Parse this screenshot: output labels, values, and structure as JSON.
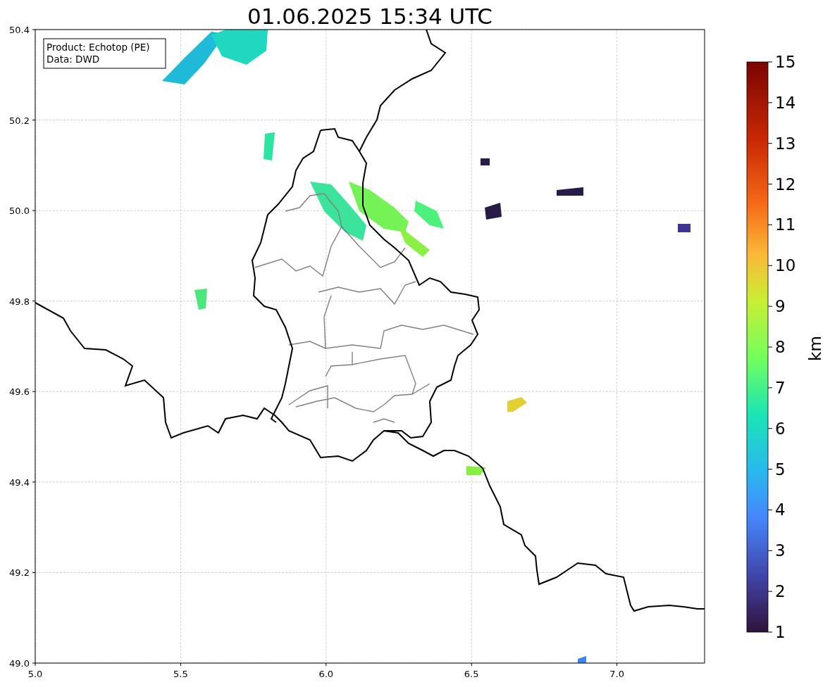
{
  "title": "01.06.2025 15:34 UTC",
  "legend": [
    "Product: Echotop (PE)",
    "Data: DWD"
  ],
  "x_ticks": [
    "5.0",
    "5.5",
    "6.0",
    "6.5",
    "7.0"
  ],
  "y_ticks": [
    "50.4",
    "50.2",
    "50.0",
    "49.8",
    "49.6",
    "49.4",
    "49.2",
    "49.0"
  ],
  "colorbar": {
    "label": "km",
    "ticks": [
      "15",
      "14",
      "13",
      "12",
      "11",
      "10",
      "9",
      "8",
      "7",
      "6",
      "5",
      "4",
      "3",
      "2",
      "1"
    ]
  }
}
